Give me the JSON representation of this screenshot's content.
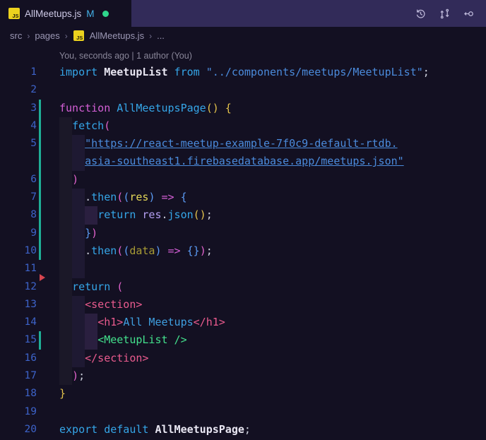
{
  "colors": {
    "editor-bg": "#131022",
    "tabbar-bg": "#322b59",
    "js-yellow": "#ecd21e",
    "dot-green": "#2fd68c",
    "mod-blue": "#43b1e8",
    "linenum-blue": "#3d63c9",
    "diff-teal": "#1fae96",
    "diff-red": "#d6454f"
  },
  "tab": {
    "js_icon_label": "JS",
    "title": "AllMeetups.js",
    "git_badge": "M"
  },
  "title_actions": [
    {
      "name": "timeline-icon"
    },
    {
      "name": "compare-changes-icon"
    },
    {
      "name": "open-changes-icon"
    }
  ],
  "breadcrumb": {
    "separator": "›",
    "item_src": "src",
    "item_pages": "pages",
    "js_icon_label": "JS",
    "item_file": "AllMeetups.js",
    "item_more": "..."
  },
  "codelens": "You, seconds ago | 1 author (You)",
  "editor": {
    "lines": [
      {
        "n": "1",
        "g": null,
        "sh": [],
        "t": [
          [
            "import ",
            "t-cyan"
          ],
          [
            "MeetupList",
            "t-white b"
          ],
          [
            " from ",
            "t-cyan"
          ],
          [
            "\"../components/meetups/MeetupList\"",
            "t-str"
          ],
          [
            ";",
            "t-punc"
          ]
        ]
      },
      {
        "n": "2",
        "g": null,
        "sh": [],
        "t": []
      },
      {
        "n": "3",
        "g": "mod",
        "sh": [],
        "t": [
          [
            "function ",
            "t-magenta"
          ],
          [
            "AllMeetupsPage",
            "t-cyan"
          ],
          [
            "()",
            "t-gold"
          ],
          [
            " {",
            "t-gold"
          ]
        ]
      },
      {
        "n": "4",
        "g": "mod",
        "sh": [
          [
            0,
            2,
            1
          ]
        ],
        "t": [
          [
            "  ",
            ""
          ],
          [
            "fetch",
            "t-cyan"
          ],
          [
            "(",
            "t-pink"
          ]
        ]
      },
      {
        "n": "5",
        "g": "mod",
        "sh": [
          [
            0,
            2,
            1
          ],
          [
            2,
            2,
            2
          ]
        ],
        "t": [
          [
            "    ",
            ""
          ],
          [
            "\"https://react-meetup-example-7f0c9-default-rtdb.",
            "t-str u"
          ]
        ]
      },
      {
        "n": null,
        "g": "mod",
        "sh": [
          [
            0,
            2,
            1
          ],
          [
            2,
            2,
            2
          ]
        ],
        "t": [
          [
            "    ",
            ""
          ],
          [
            "asia-southeast1.firebasedatabase.app/meetups.json\"",
            "t-str u"
          ]
        ]
      },
      {
        "n": "6",
        "g": "mod",
        "sh": [
          [
            0,
            2,
            1
          ]
        ],
        "t": [
          [
            "  ",
            ""
          ],
          [
            ")",
            "t-pink"
          ]
        ]
      },
      {
        "n": "7",
        "g": "mod",
        "sh": [
          [
            0,
            2,
            1
          ],
          [
            2,
            2,
            2
          ]
        ],
        "t": [
          [
            "    ",
            ""
          ],
          [
            ".",
            "t-punc"
          ],
          [
            "then",
            "t-cyan"
          ],
          [
            "(",
            "t-pink"
          ],
          [
            "(",
            "t-blue"
          ],
          [
            "res",
            "t-param"
          ],
          [
            ")",
            "t-blue"
          ],
          [
            " ",
            ""
          ],
          [
            "=>",
            "t-magenta"
          ],
          [
            " ",
            ""
          ],
          [
            "{",
            "t-blue"
          ]
        ]
      },
      {
        "n": "8",
        "g": "mod",
        "sh": [
          [
            0,
            2,
            1
          ],
          [
            2,
            2,
            2
          ],
          [
            4,
            2,
            3
          ]
        ],
        "t": [
          [
            "      ",
            ""
          ],
          [
            "return ",
            "t-cyan"
          ],
          [
            "res",
            "t-lav"
          ],
          [
            ".",
            "t-punc"
          ],
          [
            "json",
            "t-cyan"
          ],
          [
            "()",
            "t-gold"
          ],
          [
            ";",
            "t-punc"
          ]
        ]
      },
      {
        "n": "9",
        "g": "mod",
        "sh": [
          [
            0,
            2,
            1
          ],
          [
            2,
            2,
            2
          ]
        ],
        "t": [
          [
            "    ",
            ""
          ],
          [
            "}",
            "t-blue"
          ],
          [
            ")",
            "t-pink"
          ]
        ]
      },
      {
        "n": "10",
        "g": "mod",
        "sh": [
          [
            0,
            2,
            1
          ],
          [
            2,
            2,
            2
          ]
        ],
        "t": [
          [
            "    ",
            ""
          ],
          [
            ".",
            "t-punc"
          ],
          [
            "then",
            "t-cyan"
          ],
          [
            "(",
            "t-pink"
          ],
          [
            "(",
            "t-blue"
          ],
          [
            "data",
            "t-paramdim"
          ],
          [
            ")",
            "t-blue"
          ],
          [
            " ",
            ""
          ],
          [
            "=>",
            "t-magenta"
          ],
          [
            " ",
            ""
          ],
          [
            "{}",
            "t-blue"
          ],
          [
            ")",
            "t-pink"
          ],
          [
            ";",
            "t-punc"
          ]
        ]
      },
      {
        "n": "11",
        "g": null,
        "sh": [
          [
            0,
            2,
            1
          ],
          [
            2,
            2,
            2
          ]
        ],
        "t": []
      },
      {
        "n": "12",
        "g": "del",
        "sh": [
          [
            0,
            2,
            1
          ]
        ],
        "t": [
          [
            "  ",
            ""
          ],
          [
            "return ",
            "t-cyan"
          ],
          [
            "(",
            "t-pink"
          ]
        ]
      },
      {
        "n": "13",
        "g": null,
        "sh": [
          [
            0,
            2,
            1
          ],
          [
            2,
            2,
            2
          ]
        ],
        "t": [
          [
            "    ",
            ""
          ],
          [
            "<section>",
            "t-tag"
          ]
        ]
      },
      {
        "n": "14",
        "g": null,
        "sh": [
          [
            0,
            2,
            1
          ],
          [
            2,
            2,
            2
          ],
          [
            4,
            2,
            3
          ]
        ],
        "t": [
          [
            "      ",
            ""
          ],
          [
            "<h1>",
            "t-tag"
          ],
          [
            "All Meetups",
            "t-jsx"
          ],
          [
            "</h1>",
            "t-tag"
          ]
        ]
      },
      {
        "n": "15",
        "g": "mod",
        "sh": [
          [
            0,
            2,
            1
          ],
          [
            2,
            2,
            2
          ],
          [
            4,
            2,
            3
          ]
        ],
        "t": [
          [
            "      ",
            ""
          ],
          [
            "<MeetupList />",
            "t-green"
          ]
        ]
      },
      {
        "n": "16",
        "g": null,
        "sh": [
          [
            0,
            2,
            1
          ],
          [
            2,
            2,
            2
          ]
        ],
        "t": [
          [
            "    ",
            ""
          ],
          [
            "</section>",
            "t-tag"
          ]
        ]
      },
      {
        "n": "17",
        "g": null,
        "sh": [
          [
            0,
            2,
            1
          ]
        ],
        "t": [
          [
            "  ",
            ""
          ],
          [
            ")",
            "t-pink"
          ],
          [
            ";",
            "t-punc"
          ]
        ]
      },
      {
        "n": "18",
        "g": null,
        "sh": [],
        "t": [
          [
            "}",
            "t-gold"
          ]
        ]
      },
      {
        "n": "19",
        "g": null,
        "sh": [],
        "t": []
      },
      {
        "n": "20",
        "g": null,
        "sh": [],
        "t": [
          [
            "export default ",
            "t-cyan"
          ],
          [
            "AllMeetupsPage",
            "t-white b"
          ],
          [
            ";",
            "t-punc"
          ]
        ]
      }
    ]
  }
}
